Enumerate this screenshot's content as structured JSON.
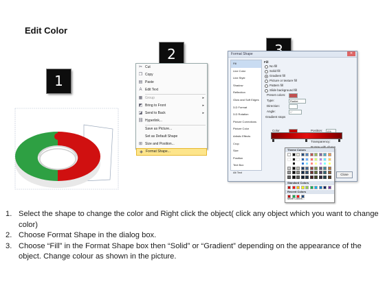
{
  "title": "Edit Color",
  "badges": [
    "1",
    "2",
    "3"
  ],
  "context_menu": {
    "items": [
      {
        "label": "Cut",
        "icon": "scissors-icon",
        "state": "normal",
        "submenu": false
      },
      {
        "label": "Copy",
        "icon": "copy-icon",
        "state": "normal",
        "submenu": false
      },
      {
        "label": "Paste",
        "icon": "paste-icon",
        "state": "normal",
        "submenu": false
      },
      {
        "label": "Edit Text",
        "icon": "edit-text-icon",
        "state": "normal",
        "submenu": false
      },
      {
        "label": "Group",
        "icon": "group-icon",
        "state": "disabled",
        "submenu": true
      },
      {
        "label": "Bring to Front",
        "icon": "bring-front-icon",
        "state": "normal",
        "submenu": true
      },
      {
        "label": "Send to Back",
        "icon": "send-back-icon",
        "state": "normal",
        "submenu": true
      },
      {
        "label": "Hyperlink...",
        "icon": "hyperlink-icon",
        "state": "normal",
        "submenu": false
      },
      {
        "label": "Save as Picture...",
        "icon": "",
        "state": "normal",
        "submenu": false
      },
      {
        "label": "Set as Default Shape",
        "icon": "",
        "state": "normal",
        "submenu": false
      },
      {
        "label": "Size and Position...",
        "icon": "size-icon",
        "state": "normal",
        "submenu": false
      },
      {
        "label": "Format Shape...",
        "icon": "format-icon",
        "state": "highlighted",
        "submenu": false
      }
    ]
  },
  "dialog": {
    "title": "Format Shape",
    "nav": [
      "Fill",
      "Line Color",
      "Line Style",
      "Shadow",
      "Reflection",
      "Glow and Soft Edges",
      "3-D Format",
      "3-D Rotation",
      "Picture Corrections",
      "Picture Color",
      "Artistic Effects",
      "Crop",
      "Size",
      "Position",
      "Text Box",
      "Alt Text"
    ],
    "section": "Fill",
    "fill_options": [
      "No fill",
      "Solid fill",
      "Gradient fill",
      "Picture or texture fill",
      "Pattern fill",
      "Slide background fill"
    ],
    "selected_fill": 2,
    "preset_label": "Preset colors:",
    "type_label": "Type:",
    "type_value": "Radial",
    "direction_label": "Direction:",
    "angle_label": "Angle:",
    "angle_value": "0°",
    "stops_label": "Gradient stops",
    "color_label": "Color",
    "position_label": "Position:",
    "position_value": "0%",
    "brightness_label": "Brightness:",
    "transparency_label": "Transparency:",
    "rotate_label": "Rotate with shape",
    "close_label": "Close"
  },
  "palette": {
    "theme_label": "Theme Colors",
    "standard_label": "Standard Colors",
    "recent_label": "Recent Colors",
    "more_label": "More Colors...",
    "theme_colors": [
      "#ffffff",
      "#000000",
      "#eeece1",
      "#1f497d",
      "#4f81bd",
      "#c0504d",
      "#9bbb59",
      "#8064a2",
      "#4bacc6",
      "#f79646"
    ],
    "standard_colors": [
      "#c00000",
      "#ff0000",
      "#ffc000",
      "#ffff00",
      "#92d050",
      "#00b050",
      "#00b0f0",
      "#0070c0",
      "#002060",
      "#7030a0"
    ],
    "recent_colors": [
      "#c00000",
      "#00b050",
      "#ff0000",
      "#1f497d"
    ]
  },
  "instructions": [
    {
      "num": "1.",
      "text": "Select the shape to change the color and Right click the object( click any object which you want to change color)"
    },
    {
      "num": "2.",
      "text": "Choose Format Shape in the dialog box."
    },
    {
      "num": "3.",
      "text": "Choose “Fill” in the Format Shape box then “Solid” or “Gradient” depending on the appearance of the object. Change colour as shown in the picture."
    }
  ],
  "colors": {
    "green": "#2ea043",
    "red": "#d01010",
    "badge": "#0d0d0d",
    "highlight": "#fde58b"
  }
}
